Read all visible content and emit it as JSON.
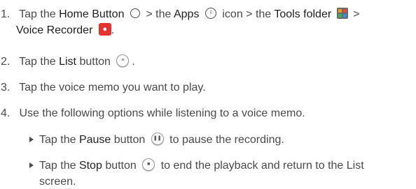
{
  "steps": [
    {
      "number": "1.",
      "pre": "Tap the",
      "home_label": "Home Button",
      "sep1": "> the",
      "apps_label": "Apps",
      "apps_suffix": "icon",
      "sep2": "> the",
      "tools_label": "Tools folder",
      "sep3": ">",
      "recorder_label": "Voice Recorder",
      "end": "."
    },
    {
      "number": "2.",
      "pre": "Tap the",
      "list_label": "List",
      "post": "button",
      "end": "."
    },
    {
      "number": "3.",
      "text": "Tap the voice memo you want to play."
    },
    {
      "number": "4.",
      "text": "Use the following options while listening to a voice memo."
    }
  ],
  "options": [
    {
      "pre": "Tap the",
      "label": "Pause",
      "post1": "button",
      "post2": "to pause the recording."
    },
    {
      "pre": "Tap the",
      "label": "Stop",
      "post1": "button",
      "post2": "to end the playback and return to the List",
      "line2": "screen."
    }
  ],
  "icons": {
    "home": "home-circle-icon",
    "apps": "apps-grid-icon",
    "tools": "tools-folder-icon",
    "recorder": "voice-recorder-icon",
    "list": "list-button-icon",
    "pause": "pause-button-icon",
    "stop": "stop-button-icon"
  },
  "colors": {
    "text": "#4a4a4a",
    "bold_text": "#1f1f1f",
    "recorder_red": "#e5322d"
  }
}
